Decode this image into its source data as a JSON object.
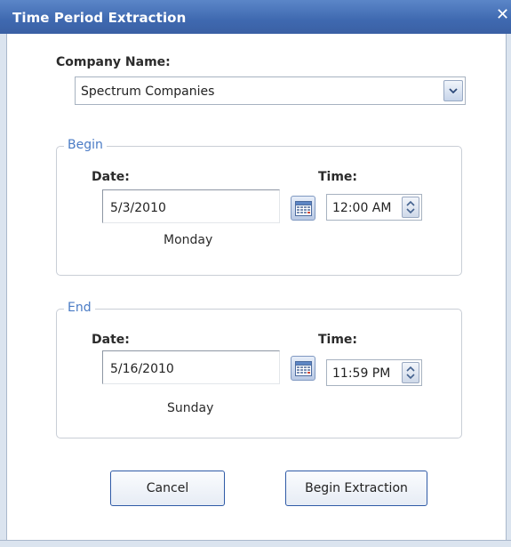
{
  "window": {
    "title": "Time Period Extraction",
    "close_symbol": "✕"
  },
  "company": {
    "label": "Company Name:",
    "selected": "Spectrum Companies"
  },
  "begin": {
    "legend": "Begin",
    "date_label": "Date:",
    "date_value": "5/3/2010",
    "weekday": "Monday",
    "time_label": "Time:",
    "time_value": "12:00 AM"
  },
  "end": {
    "legend": "End",
    "date_label": "Date:",
    "date_value": "5/16/2010",
    "weekday": "Sunday",
    "time_label": "Time:",
    "time_value": "11:59 PM"
  },
  "buttons": {
    "cancel": "Cancel",
    "begin_extraction": "Begin Extraction"
  },
  "icons": {
    "dropdown": "chevron-down-icon",
    "calendar": "calendar-icon",
    "spinner": "spinner-icon",
    "close": "close-icon"
  },
  "colors": {
    "titlebar": "#3f69b0",
    "legend_text": "#4a7bc5",
    "button_border": "#2f5aa6"
  }
}
